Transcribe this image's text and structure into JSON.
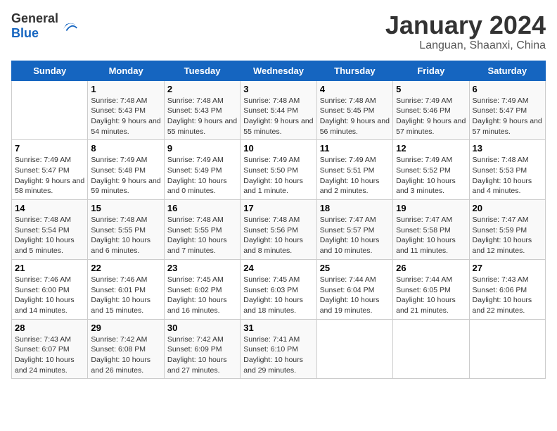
{
  "header": {
    "logo_general": "General",
    "logo_blue": "Blue",
    "month_year": "January 2024",
    "location": "Languan, Shaanxi, China"
  },
  "days_of_week": [
    "Sunday",
    "Monday",
    "Tuesday",
    "Wednesday",
    "Thursday",
    "Friday",
    "Saturday"
  ],
  "weeks": [
    [
      {
        "day": "",
        "info": ""
      },
      {
        "day": "1",
        "info": "Sunrise: 7:48 AM\nSunset: 5:43 PM\nDaylight: 9 hours and 54 minutes."
      },
      {
        "day": "2",
        "info": "Sunrise: 7:48 AM\nSunset: 5:43 PM\nDaylight: 9 hours and 55 minutes."
      },
      {
        "day": "3",
        "info": "Sunrise: 7:48 AM\nSunset: 5:44 PM\nDaylight: 9 hours and 55 minutes."
      },
      {
        "day": "4",
        "info": "Sunrise: 7:48 AM\nSunset: 5:45 PM\nDaylight: 9 hours and 56 minutes."
      },
      {
        "day": "5",
        "info": "Sunrise: 7:49 AM\nSunset: 5:46 PM\nDaylight: 9 hours and 57 minutes."
      },
      {
        "day": "6",
        "info": "Sunrise: 7:49 AM\nSunset: 5:47 PM\nDaylight: 9 hours and 57 minutes."
      }
    ],
    [
      {
        "day": "7",
        "info": "Sunrise: 7:49 AM\nSunset: 5:47 PM\nDaylight: 9 hours and 58 minutes."
      },
      {
        "day": "8",
        "info": "Sunrise: 7:49 AM\nSunset: 5:48 PM\nDaylight: 9 hours and 59 minutes."
      },
      {
        "day": "9",
        "info": "Sunrise: 7:49 AM\nSunset: 5:49 PM\nDaylight: 10 hours and 0 minutes."
      },
      {
        "day": "10",
        "info": "Sunrise: 7:49 AM\nSunset: 5:50 PM\nDaylight: 10 hours and 1 minute."
      },
      {
        "day": "11",
        "info": "Sunrise: 7:49 AM\nSunset: 5:51 PM\nDaylight: 10 hours and 2 minutes."
      },
      {
        "day": "12",
        "info": "Sunrise: 7:49 AM\nSunset: 5:52 PM\nDaylight: 10 hours and 3 minutes."
      },
      {
        "day": "13",
        "info": "Sunrise: 7:48 AM\nSunset: 5:53 PM\nDaylight: 10 hours and 4 minutes."
      }
    ],
    [
      {
        "day": "14",
        "info": "Sunrise: 7:48 AM\nSunset: 5:54 PM\nDaylight: 10 hours and 5 minutes."
      },
      {
        "day": "15",
        "info": "Sunrise: 7:48 AM\nSunset: 5:55 PM\nDaylight: 10 hours and 6 minutes."
      },
      {
        "day": "16",
        "info": "Sunrise: 7:48 AM\nSunset: 5:55 PM\nDaylight: 10 hours and 7 minutes."
      },
      {
        "day": "17",
        "info": "Sunrise: 7:48 AM\nSunset: 5:56 PM\nDaylight: 10 hours and 8 minutes."
      },
      {
        "day": "18",
        "info": "Sunrise: 7:47 AM\nSunset: 5:57 PM\nDaylight: 10 hours and 10 minutes."
      },
      {
        "day": "19",
        "info": "Sunrise: 7:47 AM\nSunset: 5:58 PM\nDaylight: 10 hours and 11 minutes."
      },
      {
        "day": "20",
        "info": "Sunrise: 7:47 AM\nSunset: 5:59 PM\nDaylight: 10 hours and 12 minutes."
      }
    ],
    [
      {
        "day": "21",
        "info": "Sunrise: 7:46 AM\nSunset: 6:00 PM\nDaylight: 10 hours and 14 minutes."
      },
      {
        "day": "22",
        "info": "Sunrise: 7:46 AM\nSunset: 6:01 PM\nDaylight: 10 hours and 15 minutes."
      },
      {
        "day": "23",
        "info": "Sunrise: 7:45 AM\nSunset: 6:02 PM\nDaylight: 10 hours and 16 minutes."
      },
      {
        "day": "24",
        "info": "Sunrise: 7:45 AM\nSunset: 6:03 PM\nDaylight: 10 hours and 18 minutes."
      },
      {
        "day": "25",
        "info": "Sunrise: 7:44 AM\nSunset: 6:04 PM\nDaylight: 10 hours and 19 minutes."
      },
      {
        "day": "26",
        "info": "Sunrise: 7:44 AM\nSunset: 6:05 PM\nDaylight: 10 hours and 21 minutes."
      },
      {
        "day": "27",
        "info": "Sunrise: 7:43 AM\nSunset: 6:06 PM\nDaylight: 10 hours and 22 minutes."
      }
    ],
    [
      {
        "day": "28",
        "info": "Sunrise: 7:43 AM\nSunset: 6:07 PM\nDaylight: 10 hours and 24 minutes."
      },
      {
        "day": "29",
        "info": "Sunrise: 7:42 AM\nSunset: 6:08 PM\nDaylight: 10 hours and 26 minutes."
      },
      {
        "day": "30",
        "info": "Sunrise: 7:42 AM\nSunset: 6:09 PM\nDaylight: 10 hours and 27 minutes."
      },
      {
        "day": "31",
        "info": "Sunrise: 7:41 AM\nSunset: 6:10 PM\nDaylight: 10 hours and 29 minutes."
      },
      {
        "day": "",
        "info": ""
      },
      {
        "day": "",
        "info": ""
      },
      {
        "day": "",
        "info": ""
      }
    ]
  ]
}
